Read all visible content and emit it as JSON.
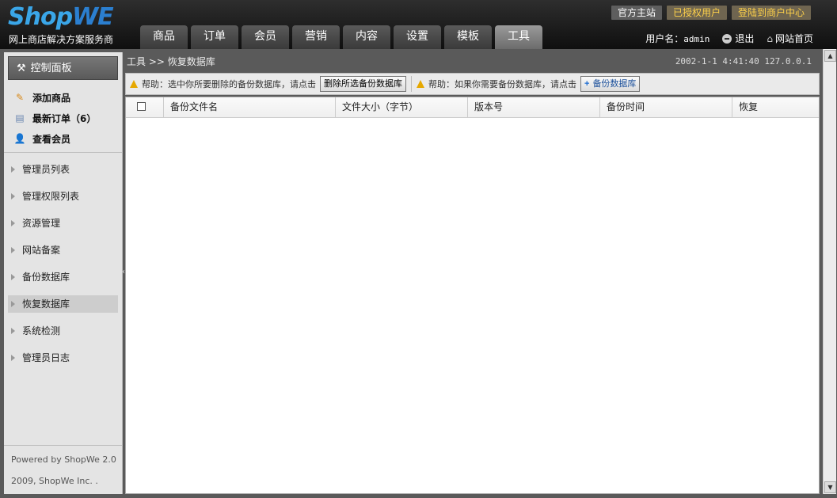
{
  "header": {
    "logo_part1": "Shop",
    "logo_part2": "WE",
    "tagline": "网上商店解决方案服务商",
    "top_links": [
      "官方主站",
      "已授权用户",
      "登陆到商户中心"
    ],
    "nav_tabs": [
      "商品",
      "订单",
      "会员",
      "营销",
      "内容",
      "设置",
      "模板",
      "工具"
    ],
    "active_tab": "工具",
    "user_label": "用户名：",
    "username": "admin",
    "logout": "退出",
    "site_home": "网站首页"
  },
  "sidebar": {
    "panel_title": "控制面板",
    "quick_items": [
      {
        "label": "添加商品",
        "icon": "pencil-icon"
      },
      {
        "label": "最新订单（6）",
        "icon": "document-icon"
      },
      {
        "label": "查看会员",
        "icon": "user-icon"
      }
    ],
    "menu_items": [
      "管理员列表",
      "管理权限列表",
      "资源管理",
      "网站备案",
      "备份数据库",
      "恢复数据库",
      "系统检测",
      "管理员日志"
    ],
    "active_item": "恢复数据库",
    "footer_powered": "Powered by ShopWe 2.0",
    "footer_copyright": "2009, ShopWe Inc. ."
  },
  "main": {
    "breadcrumb": "工具 >> 恢复数据库",
    "meta": "2002-1-1 4:41:40 127.0.0.1",
    "help1": "帮助：选中你所要删除的备份数据库，请点击",
    "delete_button": "删除所选备份数据库",
    "help2": "帮助：如果你需要备份数据库，请点击",
    "backup_button": "备份数据库",
    "columns": [
      "备份文件名",
      "文件大小（字节）",
      "版本号",
      "备份时间",
      "恢复"
    ]
  }
}
